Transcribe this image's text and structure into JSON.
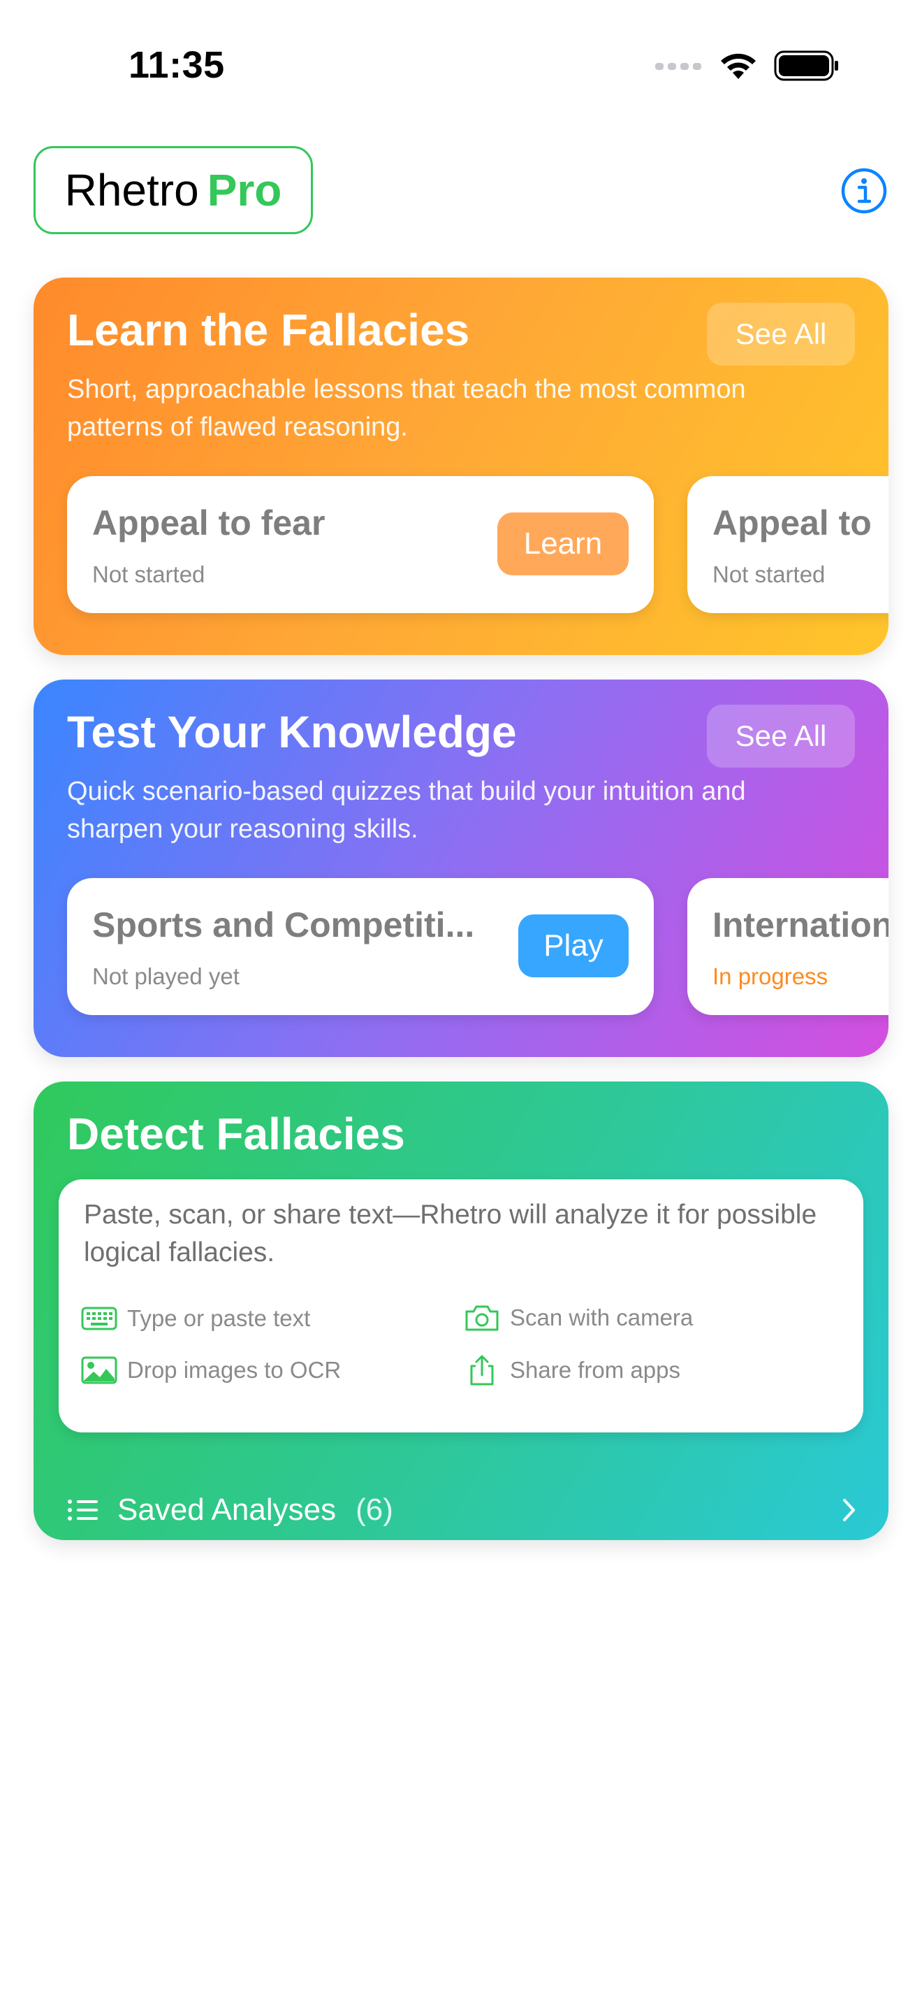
{
  "status_bar": {
    "time": "11:35"
  },
  "header": {
    "brand": "Rhetro",
    "tier": "Pro"
  },
  "learn": {
    "title": "Learn the Fallacies",
    "description": "Short, approachable lessons that teach the most common patterns of flawed reasoning.",
    "see_all": "See All",
    "items": [
      {
        "title": "Appeal to fear",
        "status": "Not started",
        "button": "Learn"
      },
      {
        "title": "Appeal to",
        "status": "Not started"
      }
    ]
  },
  "quiz": {
    "title": "Test Your Knowledge",
    "description": "Quick scenario-based quizzes that build your intuition and sharpen your reasoning skills.",
    "see_all": "See All",
    "items": [
      {
        "title": "Sports and Competiti...",
        "status": "Not played yet",
        "button": "Play"
      },
      {
        "title": "Internation",
        "status": "In progress"
      }
    ]
  },
  "detect": {
    "title": "Detect Fallacies",
    "description": "Paste, scan, or share text—Rhetro will analyze it for possible logical fallacies.",
    "features": [
      {
        "label": "Type or paste text",
        "icon": "keyboard-icon"
      },
      {
        "label": "Scan with camera",
        "icon": "camera-icon"
      },
      {
        "label": "Drop images to OCR",
        "icon": "photo-icon"
      },
      {
        "label": "Share from apps",
        "icon": "share-icon"
      }
    ],
    "saved_label": "Saved Analyses",
    "saved_count": "(6)"
  },
  "colors": {
    "accent_green": "#34c759",
    "info_blue": "#0a84ff",
    "learn_button": "#ffa85a",
    "play_button": "#36a6ff",
    "in_progress": "#ff8a1f"
  }
}
